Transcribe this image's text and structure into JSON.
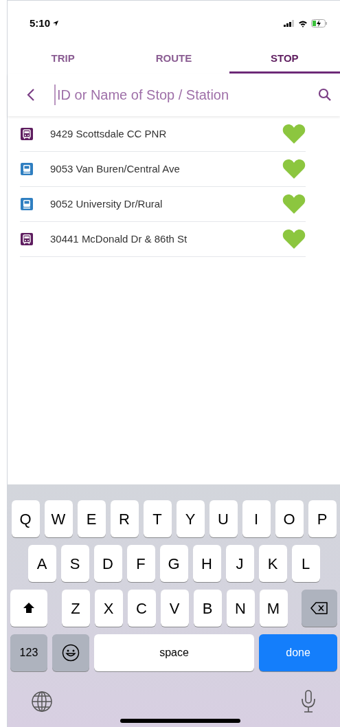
{
  "status_bar": {
    "time": "5:10"
  },
  "tabs": [
    {
      "label": "TRIP",
      "selected": false
    },
    {
      "label": "ROUTE",
      "selected": false
    },
    {
      "label": "STOP",
      "selected": true
    }
  ],
  "search": {
    "placeholder": "ID or Name of Stop / Station"
  },
  "stops": [
    {
      "kind": "rail",
      "color": "#5e1d5f",
      "name": "9429 Scottsdale CC PNR",
      "favorite": true
    },
    {
      "kind": "bus",
      "color": "#2f7fc1",
      "name": "9053 Van Buren/Central Ave",
      "favorite": true
    },
    {
      "kind": "bus",
      "color": "#2f7fc1",
      "name": "9052 University Dr/Rural",
      "favorite": true
    },
    {
      "kind": "rail",
      "color": "#5e1d5f",
      "name": "30441 McDonald Dr & 86th St",
      "favorite": true
    }
  ],
  "keyboard": {
    "rows": [
      {
        "keys": [
          {
            "kind": "letter",
            "label": "Q"
          },
          {
            "kind": "letter",
            "label": "W"
          },
          {
            "kind": "letter",
            "label": "E"
          },
          {
            "kind": "letter",
            "label": "R"
          },
          {
            "kind": "letter",
            "label": "T"
          },
          {
            "kind": "letter",
            "label": "Y"
          },
          {
            "kind": "letter",
            "label": "U"
          },
          {
            "kind": "letter",
            "label": "I"
          },
          {
            "kind": "letter",
            "label": "O"
          },
          {
            "kind": "letter",
            "label": "P"
          }
        ]
      },
      {
        "keys": [
          {
            "kind": "letter",
            "label": "A"
          },
          {
            "kind": "letter",
            "label": "S"
          },
          {
            "kind": "letter",
            "label": "D"
          },
          {
            "kind": "letter",
            "label": "F"
          },
          {
            "kind": "letter",
            "label": "G"
          },
          {
            "kind": "letter",
            "label": "H"
          },
          {
            "kind": "letter",
            "label": "J"
          },
          {
            "kind": "letter",
            "label": "K"
          },
          {
            "kind": "letter",
            "label": "L"
          }
        ]
      },
      {
        "keys": [
          {
            "kind": "shift"
          },
          {
            "kind": "letter",
            "label": "Z"
          },
          {
            "kind": "letter",
            "label": "X"
          },
          {
            "kind": "letter",
            "label": "C"
          },
          {
            "kind": "letter",
            "label": "V"
          },
          {
            "kind": "letter",
            "label": "B"
          },
          {
            "kind": "letter",
            "label": "N"
          },
          {
            "kind": "letter",
            "label": "M"
          },
          {
            "kind": "delete"
          }
        ]
      },
      {
        "keys": [
          {
            "kind": "numbers",
            "label": "123"
          },
          {
            "kind": "emoji"
          },
          {
            "kind": "space",
            "label": "space"
          },
          {
            "kind": "done",
            "label": "done"
          }
        ]
      }
    ]
  }
}
